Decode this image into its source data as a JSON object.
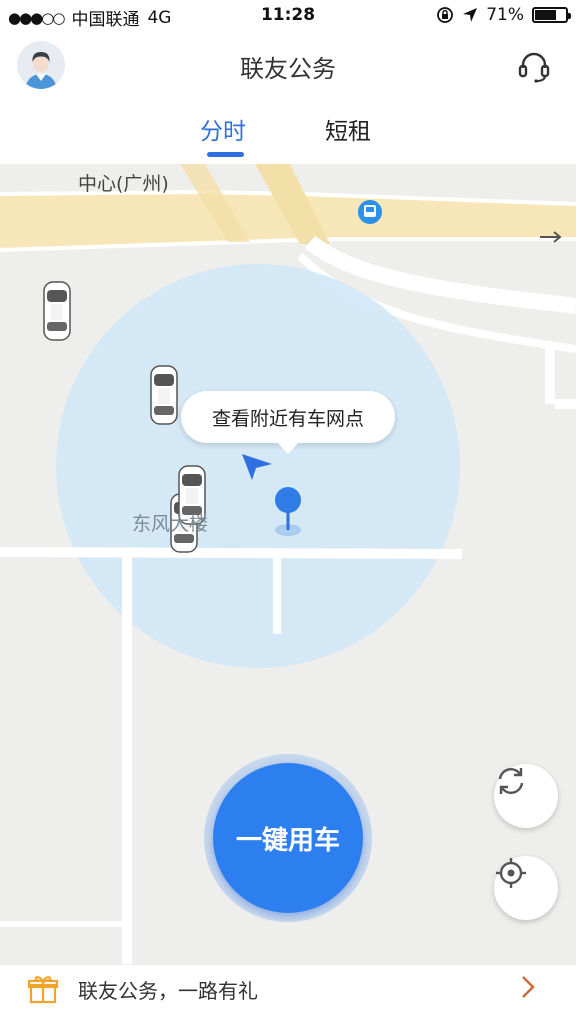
{
  "status_bar": {
    "signal": "●●●○○",
    "carrier": "中国联通",
    "network": "4G",
    "time": "11:28",
    "battery_percent": "71%",
    "battery_level": 0.71
  },
  "header": {
    "title": "联友公务",
    "avatar_icon": "user-avatar-icon",
    "support_icon": "headset-icon"
  },
  "tabs": [
    {
      "label": "分时",
      "active": true
    },
    {
      "label": "短租",
      "active": false
    }
  ],
  "map": {
    "poi_top": "中心(广州)",
    "poi_building": "东风大楼",
    "tooltip": "查看附近有车网点",
    "bus_stop_icon": "bus-stop-icon"
  },
  "actions": {
    "one_click_label": "一键用车",
    "refresh_icon": "refresh-icon",
    "locate_icon": "locate-icon"
  },
  "promo": {
    "text": "联友公务，一路有礼",
    "gift_icon": "gift-icon",
    "chevron_icon": "chevron-right-icon"
  },
  "colors": {
    "accent": "#2f6fdf",
    "button": "#2d7ff0",
    "range_circle": "#cfe6f8",
    "road_yellow": "#f7e6b8",
    "promo_chevron": "#c96a3a"
  }
}
